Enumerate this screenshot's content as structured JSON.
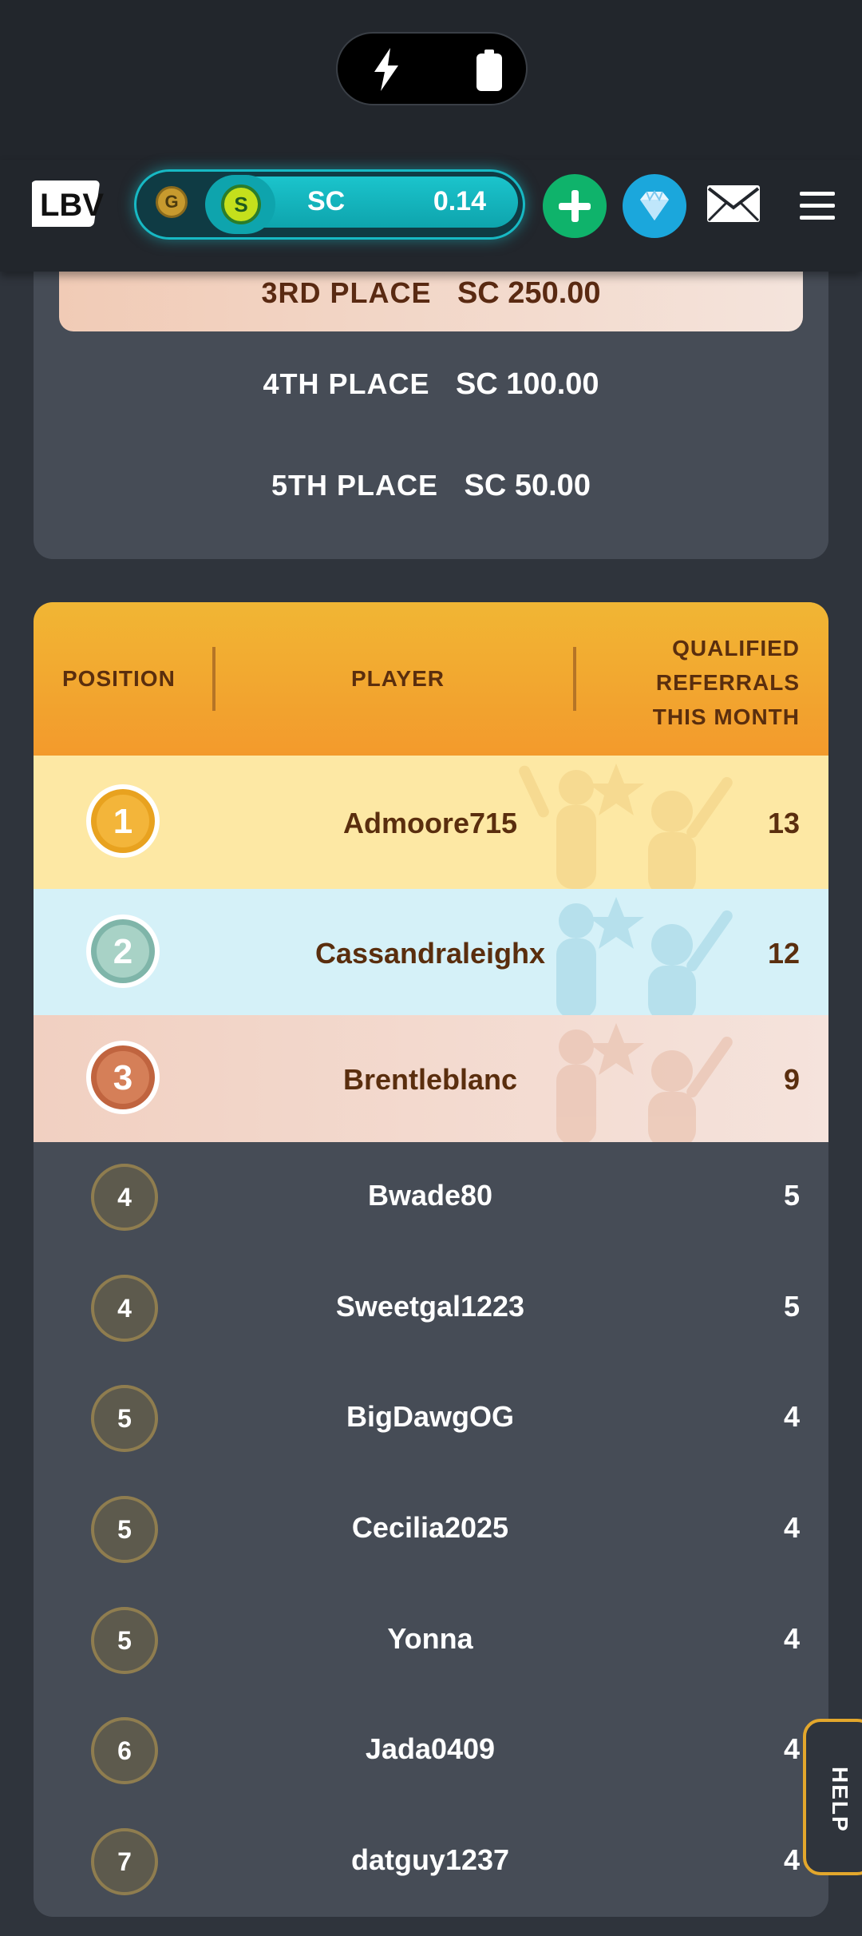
{
  "header": {
    "balance_label": "SC",
    "balance_value": "0.14",
    "coin_g": "G",
    "coin_s": "S",
    "logo": "LBV",
    "icons": [
      "plus-icon",
      "gem-icon",
      "mail-icon",
      "menu-icon"
    ]
  },
  "prizes": [
    {
      "place": "3RD PLACE",
      "amount": "SC 250.00"
    },
    {
      "place": "4TH PLACE",
      "amount": "SC 100.00"
    },
    {
      "place": "5TH PLACE",
      "amount": "SC 50.00"
    }
  ],
  "leaderboard": {
    "columns": {
      "position": "POSITION",
      "player": "PLAYER",
      "referrals": "QUALIFIED REFERRALS THIS MONTH"
    },
    "rows": [
      {
        "position": "1",
        "player": "Admoore715",
        "count": "13"
      },
      {
        "position": "2",
        "player": "Cassandraleighx",
        "count": "12"
      },
      {
        "position": "3",
        "player": "Brentleblanc",
        "count": "9"
      },
      {
        "position": "4",
        "player": "Bwade80",
        "count": "5"
      },
      {
        "position": "4",
        "player": "Sweetgal1223",
        "count": "5"
      },
      {
        "position": "5",
        "player": "BigDawgOG",
        "count": "4"
      },
      {
        "position": "5",
        "player": "Cecilia2025",
        "count": "4"
      },
      {
        "position": "5",
        "player": "Yonna",
        "count": "4"
      },
      {
        "position": "6",
        "player": "Jada0409",
        "count": "4"
      },
      {
        "position": "7",
        "player": "datguy1237",
        "count": "4"
      }
    ]
  },
  "help": "HELP",
  "colors": {
    "gold": "#fbe6a0",
    "silver": "#d4f1f8",
    "bronze": "#f3d8cc",
    "accent": "#17b9c4"
  }
}
